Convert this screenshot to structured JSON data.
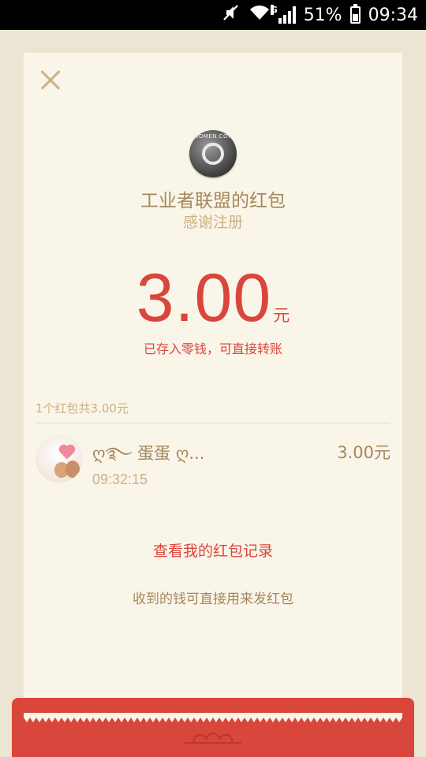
{
  "status_bar": {
    "battery": "51%",
    "time": "09:34",
    "network": "G"
  },
  "red_packet": {
    "sender_title": "工业者联盟的红包",
    "greeting": "感谢注册",
    "logo_text": "NOMEN.COM",
    "amount": "3.00",
    "amount_unit": "元",
    "deposit_note": "已存入零钱，可直接转账",
    "summary": "1个红包共3.00元",
    "records": [
      {
        "name": "ღ࿐ 蛋蛋 ღ...",
        "time": "09:32:15",
        "amount": "3.00元"
      }
    ],
    "history_link": "查看我的红包记录",
    "footer_note": "收到的钱可直接用来发红包"
  },
  "colors": {
    "accent_red": "#d9463b",
    "gold_text": "#a4875c",
    "light_gold": "#cbb183",
    "card_bg": "#faf5e9",
    "page_bg": "#ede5d3"
  },
  "icons": [
    "close-icon",
    "logo-icon",
    "mute-icon",
    "wifi-icon",
    "signal-icon",
    "battery-icon"
  ]
}
